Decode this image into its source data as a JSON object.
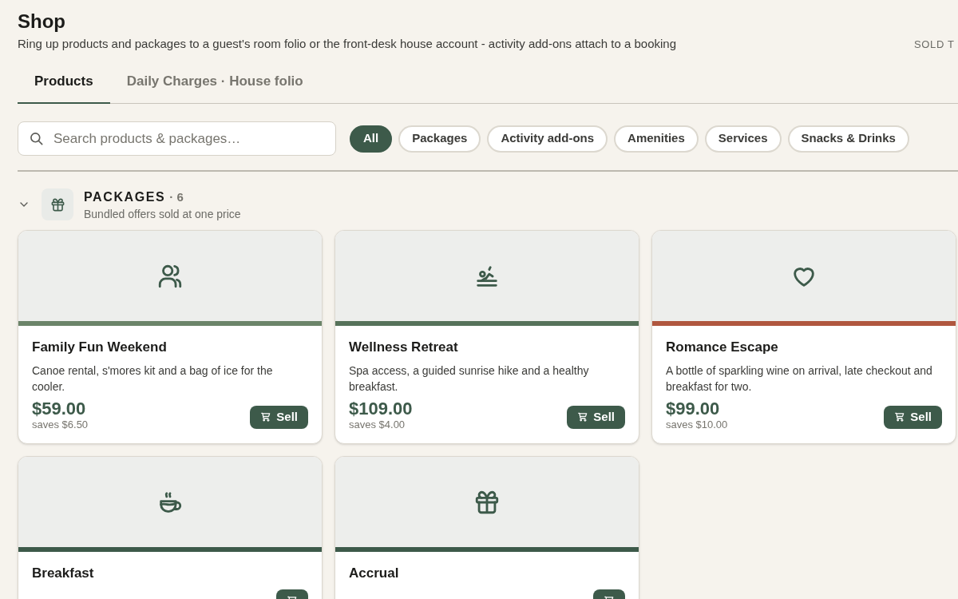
{
  "header": {
    "title": "Shop",
    "subtitle": "Ring up products and packages to a guest's room folio or the front-desk house account - activity add-ons attach to a booking",
    "sold_to_label": "SOLD T"
  },
  "tabs": [
    {
      "label": "Products",
      "selected": true
    },
    {
      "label": "Daily Charges · House folio",
      "selected": false
    }
  ],
  "search": {
    "placeholder": "Search products & packages…"
  },
  "filters": [
    {
      "label": "All",
      "selected": true
    },
    {
      "label": "Packages",
      "selected": false
    },
    {
      "label": "Activity add-ons",
      "selected": false
    },
    {
      "label": "Amenities",
      "selected": false
    },
    {
      "label": "Services",
      "selected": false
    },
    {
      "label": "Snacks & Drinks",
      "selected": false
    }
  ],
  "section": {
    "title": "PACKAGES",
    "count": "· 6",
    "subtitle": "Bundled offers sold at one price",
    "expanded": true
  },
  "cards": [
    {
      "kind": "people",
      "color": "#6b8469",
      "name": "Family Fun Weekend",
      "description": "Canoe rental, s'mores kit and a bag of ice for the cooler.",
      "price": "$59.00",
      "savings": "saves $6.50",
      "button": "Sell"
    },
    {
      "kind": "massage",
      "color": "#56725a",
      "name": "Wellness Retreat",
      "description": "Spa access, a guided sunrise hike and a healthy breakfast.",
      "price": "$109.00",
      "savings": "saves $4.00",
      "button": "Sell"
    },
    {
      "kind": "heart",
      "color": "#b0573f",
      "name": "Romance Escape",
      "description": "A bottle of sparkling wine on arrival, late checkout and breakfast for two.",
      "price": "$99.00",
      "savings": "saves $10.00",
      "button": "Sell"
    },
    {
      "kind": "coffee",
      "color": "#3d5a4a",
      "name": "Breakfast"
    },
    {
      "kind": "gift",
      "color": "#3d5a4a",
      "name": "Accrual"
    }
  ]
}
